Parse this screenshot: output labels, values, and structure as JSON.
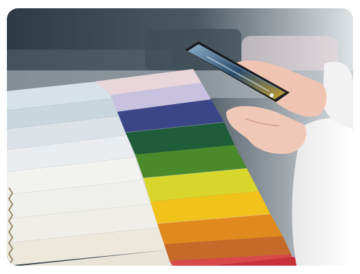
{
  "image": {
    "subject": "fabric-swatch-catalog-with-smartphone",
    "palette": {
      "sofa": "#3f4d57",
      "background": "#c9d0d4",
      "swatch_colors": [
        "#bcc8d0",
        "#e8e6ea",
        "#c8c2e0",
        "#3b4688",
        "#1f5c3a",
        "#4a8a2a",
        "#d8d62a",
        "#f0c21a",
        "#e08a1e",
        "#d06a36",
        "#d84a4a",
        "#c8303c"
      ],
      "left_stack": [
        "#d6e1e8",
        "#c9d6de",
        "#dbe3e8",
        "#e9edf0",
        "#f2f2ef",
        "#efefec",
        "#f0eee8",
        "#ece8dc",
        "#e8e4d8"
      ],
      "sleeve": "#f4f4f4",
      "skin": "#f0c8b8"
    }
  }
}
